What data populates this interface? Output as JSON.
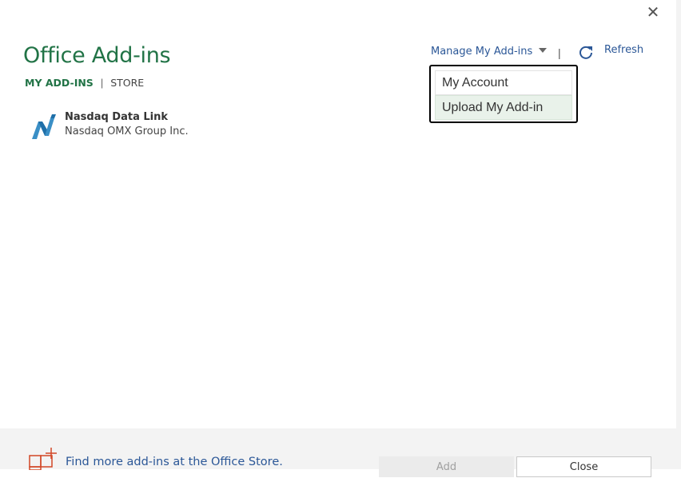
{
  "dialog": {
    "title": "Office Add-ins",
    "close_icon": "close-icon"
  },
  "tabs": {
    "my_addins": "MY ADD-INS",
    "separator": "|",
    "store": "STORE"
  },
  "addins": [
    {
      "name": "Nasdaq Data Link",
      "publisher": "Nasdaq OMX Group Inc.",
      "icon": "nasdaq-logo-icon"
    }
  ],
  "toolbar": {
    "manage_label": "Manage My Add-ins",
    "separator": "|",
    "refresh_label": "Refresh"
  },
  "manage_menu": {
    "items": [
      "My Account",
      "Upload My Add-in"
    ],
    "highlighted": "Upload My Add-in"
  },
  "footer": {
    "store_link": "Find more add-ins at the Office Store.",
    "add_button": "Add",
    "close_button": "Close"
  },
  "colors": {
    "accent_green": "#217346",
    "link_blue": "#2b5797",
    "menu_hover": "#e9f2ea",
    "store_icon_red": "#d24726"
  }
}
